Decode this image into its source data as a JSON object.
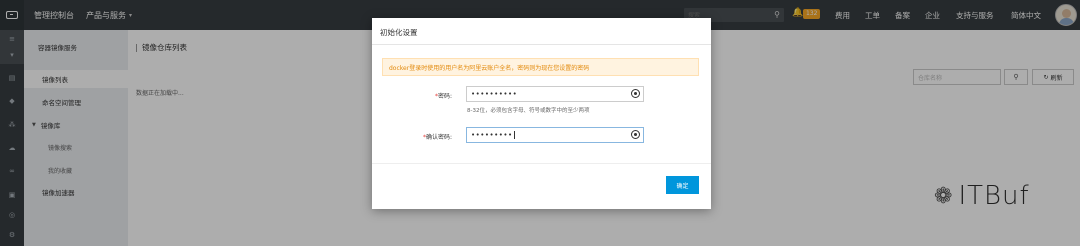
{
  "topbar": {
    "console_title": "管理控制台",
    "products_menu": "产品与服务",
    "products_caret": "▾",
    "search_placeholder": "搜索",
    "search_icon": "⚲",
    "bell_icon": "🔔",
    "notification_count": "132",
    "nav": [
      "费用",
      "工单",
      "备案",
      "企业",
      "支持与服务",
      "简体中文"
    ]
  },
  "rail": {
    "icons": [
      "menu-icon",
      "chevron-down-icon",
      "list-icon",
      "shield-icon",
      "network-icon",
      "cloud-icon",
      "link-icon",
      "storage-icon",
      "database-icon",
      "circle-icon",
      "settings-icon"
    ],
    "glyphs": [
      "≡",
      "▾",
      "▤",
      "◆",
      "⁂",
      "☁",
      "∞",
      "▣",
      "◎",
      "○",
      "⚙"
    ]
  },
  "sidebar": {
    "title": "容器镜像服务",
    "items": [
      {
        "label": "镜像列表",
        "active": true
      },
      {
        "label": "命名空间管理"
      },
      {
        "label": "镜像库",
        "group": true
      },
      {
        "label": "镜像搜索",
        "sub": true
      },
      {
        "label": "我的收藏",
        "sub": true
      },
      {
        "label": "镜像加速器"
      }
    ]
  },
  "main": {
    "title": "镜像仓库列表",
    "loading_text": "数据正在加载中...",
    "repo_search_placeholder": "仓库名称",
    "search_icon": "⚲",
    "refresh_icon": "↻",
    "refresh_label": "刷新"
  },
  "modal": {
    "title": "初始化设置",
    "notice": "docker登录时使用的用户名为阿里云账户全名，密码则为现在您设置的密码",
    "password_label": "密码:",
    "password_value": "••••••••••",
    "hint": "8-32位，必须包含字母、符号或数字中的至少两项",
    "confirm_label": "确认密码:",
    "confirm_value": "•••••••••",
    "required_mark": "*",
    "confirm_button": "确定"
  },
  "watermark": {
    "icon": "❁",
    "text": "ITBuf"
  }
}
